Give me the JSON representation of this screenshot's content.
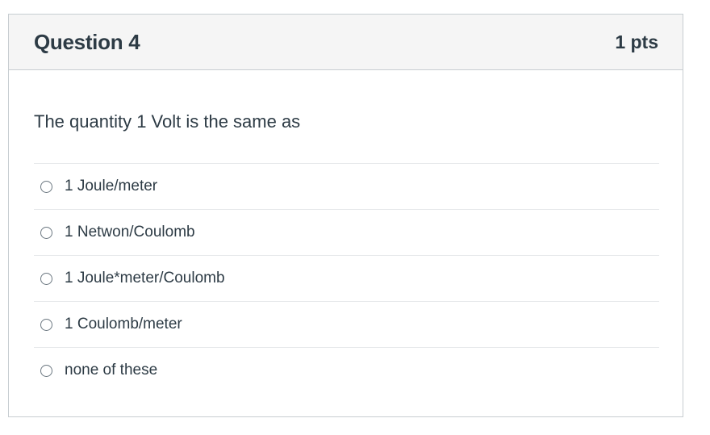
{
  "question": {
    "title": "Question 4",
    "points": "1 pts",
    "text": "The quantity 1 Volt is the same as",
    "answers": [
      {
        "label": "1 Joule/meter",
        "selected": false
      },
      {
        "label": "1 Netwon/Coulomb",
        "selected": false
      },
      {
        "label": "1 Joule*meter/Coulomb",
        "selected": false
      },
      {
        "label": "1 Coulomb/meter",
        "selected": false
      },
      {
        "label": "none of these",
        "selected": false
      }
    ]
  }
}
